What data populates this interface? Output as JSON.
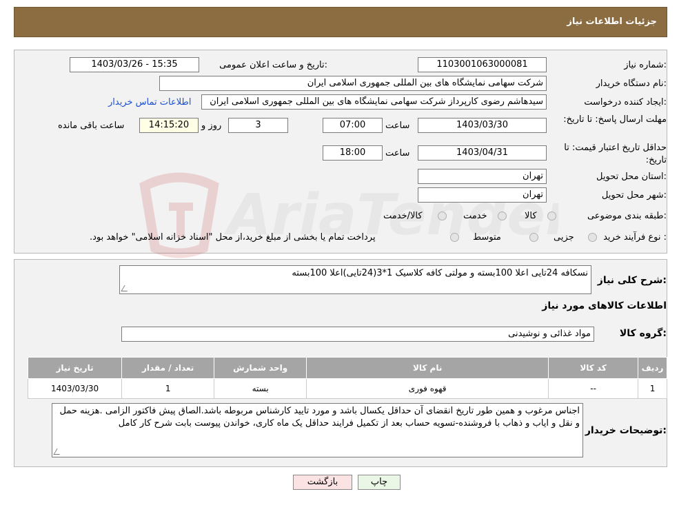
{
  "header": {
    "title": "جزئیات اطلاعات نیاز"
  },
  "watermark": {
    "text": "AriaTender.neT"
  },
  "form": {
    "need_number_label": "شماره نیاز:",
    "need_number": "1103001063000081",
    "announce_label": "تاریخ و ساعت اعلان عمومی:",
    "announce_value": "1403/03/26 - 15:35",
    "buyer_org_label": "نام دستگاه خریدار:",
    "buyer_org": "شرکت سهامی نمایشگاه های بین المللی جمهوری اسلامی ایران",
    "creator_label": "ایجاد کننده درخواست:",
    "creator": "سیدهاشم رضوی کارپرداز شرکت سهامی نمایشگاه های بین المللی جمهوری اسلامی ایران",
    "contact_link": "اطلاعات تماس خریدار",
    "reply_deadline_label": "مهلت ارسال پاسخ: تا تاریخ:",
    "reply_date": "1403/03/30",
    "time_label": "ساعت",
    "reply_time": "07:00",
    "days_value": "3",
    "days_label": "روز و",
    "remaining_time": "14:15:20",
    "remaining_label": "ساعت باقی مانده",
    "validity_label": "حداقل تاریخ اعتبار قیمت: تا تاریخ:",
    "validity_date": "1403/04/31",
    "validity_time": "18:00",
    "province_label": "استان محل تحویل:",
    "province": "تهران",
    "city_label": "شهر محل تحویل:",
    "city": "تهران",
    "category_label": "طبقه بندی موضوعی:",
    "category_options": [
      "کالا",
      "خدمت",
      "کالا/خدمت"
    ],
    "process_label": "نوع فرآیند خرید :",
    "process_options": [
      "جزیی",
      "متوسط"
    ],
    "process_note": "پرداخت تمام یا بخشی از مبلغ خرید،از محل \"اسناد خزانه اسلامی\" خواهد بود."
  },
  "details": {
    "summary_label": "شرح کلی نیاز:",
    "summary": "نسکافه 24تایی اعلا  100بسته و مولتی کافه کلاسیک 1*3(24تایی)اعلا 100بسته",
    "goods_info_title": "اطلاعات کالاهای مورد نیاز",
    "goods_group_label": "گروه کالا:",
    "goods_group": "مواد غذائی و نوشیدنی",
    "table": {
      "headers": [
        "ردیف",
        "کد کالا",
        "نام کالا",
        "واحد شمارش",
        "تعداد / مقدار",
        "تاریخ نیاز"
      ],
      "rows": [
        [
          "1",
          "--",
          "قهوه فوری",
          "بسته",
          "1",
          "1403/03/30"
        ]
      ]
    },
    "buyer_notes_label": "توضیحات خریدار:",
    "buyer_notes": "اجناس مرغوب و  همین طور تاریخ انقضای آن حداقل یکسال باشد و مورد تایید کارشناس  مربوطه باشد.الصاق پیش فاکتور الزامی .هزینه حمل و نقل و ایاب و ذهاب با فروشنده-تسویه حساب بعد از تکمیل فرایند حداقل یک ماه کاری، خواندن پیوست بابت شرح کار کامل"
  },
  "buttons": {
    "print": "چاپ",
    "back": "بازگشت"
  }
}
